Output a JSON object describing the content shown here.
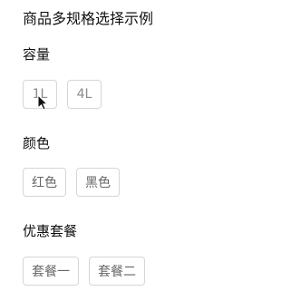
{
  "title": "商品多规格选择示例",
  "groups": [
    {
      "label": "容量",
      "options": [
        "1L",
        "4L"
      ]
    },
    {
      "label": "颜色",
      "options": [
        "红色",
        "黑色"
      ]
    },
    {
      "label": "优惠套餐",
      "options": [
        "套餐一",
        "套餐二"
      ]
    }
  ],
  "icons": {
    "cursor": "mouse-pointer-icon"
  }
}
